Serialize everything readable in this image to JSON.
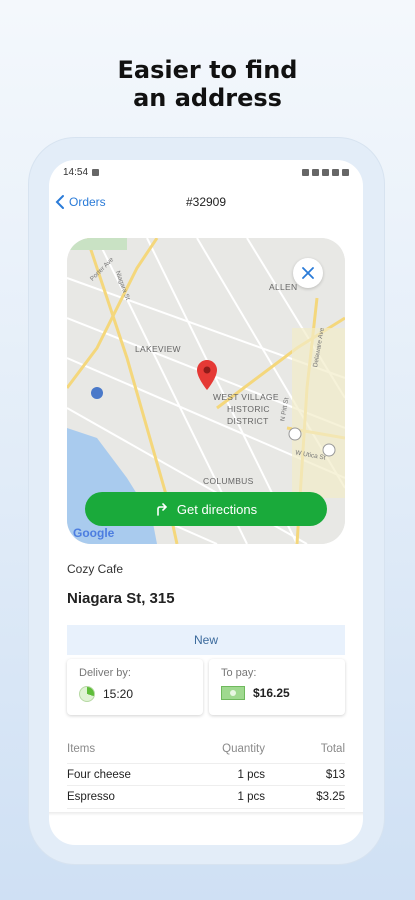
{
  "headline": {
    "line1": "Easier to find",
    "line2": "an address"
  },
  "statusbar": {
    "time": "14:54"
  },
  "appbar": {
    "back_label": "Orders",
    "order_number": "#32909"
  },
  "map": {
    "labels": [
      "LAKEVIEW",
      "WEST VILLAGE",
      "HISTORIC",
      "DISTRICT",
      "COLUMBUS",
      "ALLEN"
    ],
    "streets": [
      "Porter Ave",
      "Niagara St",
      "Delaware Ave",
      "W Utica St",
      "N Pitt St"
    ],
    "google_logo": "Google",
    "directions_label": "Get directions"
  },
  "order": {
    "place_name": "Cozy Cafe",
    "address": "Niagara St, 315",
    "status": "New",
    "deliver_by_label": "Deliver by:",
    "deliver_by_time": "15:20",
    "to_pay_label": "To pay:",
    "to_pay_amount": "$16.25"
  },
  "items_table": {
    "headers": {
      "item": "Items",
      "quantity": "Quantity",
      "total": "Total"
    },
    "rows": [
      {
        "item": "Four cheese",
        "quantity": "1 pcs",
        "total": "$13"
      },
      {
        "item": "Espresso",
        "quantity": "1 pcs",
        "total": "$3.25"
      }
    ]
  },
  "colors": {
    "accent": "#2a7bd8",
    "directions_green": "#1aaa3b",
    "status_chip": "#e8f1fc"
  }
}
